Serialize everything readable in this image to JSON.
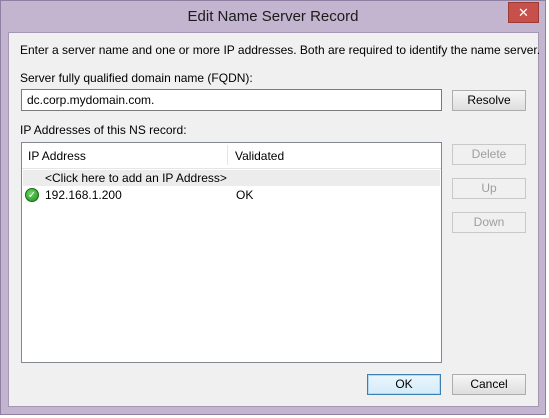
{
  "window": {
    "title": "Edit Name Server Record",
    "close_glyph": "✕"
  },
  "dialog": {
    "instruction": "Enter a server name and one or more IP addresses.  Both are required to identify the name server.",
    "fqdn_label": "Server fully qualified domain name (FQDN):",
    "fqdn_value": "dc.corp.mydomain.com.",
    "resolve_label": "Resolve",
    "ip_section_label": "IP Addresses of this NS record:",
    "columns": [
      "IP Address",
      "Validated"
    ],
    "add_row_label": "<Click here to add an IP Address>",
    "rows": [
      {
        "ip": "192.168.1.200",
        "validated": "OK",
        "status_icon": "check-icon"
      }
    ],
    "side_buttons": {
      "delete": "Delete",
      "up": "Up",
      "down": "Down"
    },
    "ok_label": "OK",
    "cancel_label": "Cancel"
  },
  "colors": {
    "frame": "#c3b4cf",
    "close": "#c7514a",
    "client": "#f0f0f0"
  }
}
